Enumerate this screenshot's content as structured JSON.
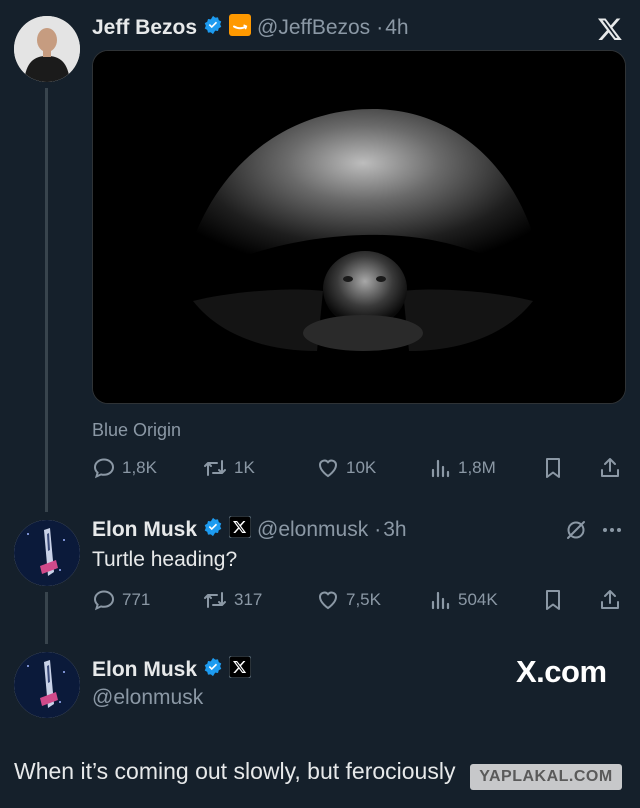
{
  "tweet1": {
    "name": "Jeff Bezos",
    "handle": "@JeffBezos",
    "dot": "·",
    "time": "4h",
    "source_label": "Blue Origin",
    "replies": "1,8K",
    "retweets": "1K",
    "likes": "10K",
    "views": "1,8M"
  },
  "tweet2": {
    "name": "Elon Musk",
    "handle": "@elonmusk",
    "dot": "·",
    "time": "3h",
    "text": "Turtle heading?",
    "replies": "771",
    "retweets": "317",
    "likes": "7,5K",
    "views": "504K"
  },
  "tweet3": {
    "name": "Elon Musk",
    "handle": "@elonmusk",
    "brand": "X.com",
    "text": "When it’s coming out slowly, but ferociously"
  },
  "watermark": "YAPLAKAL.COM",
  "colors": {
    "background": "#15202b",
    "verified": "#1d9bf0",
    "amazon_badge": "#ff9900",
    "secondary_text": "#8b98a5"
  },
  "icons": {
    "top_right": "x-logo-icon",
    "reply": "reply-icon",
    "retweet": "retweet-icon",
    "like": "heart-icon",
    "views": "views-icon",
    "bookmark": "bookmark-icon",
    "share": "share-icon",
    "grok": "grok-icon",
    "more": "more-icon"
  }
}
